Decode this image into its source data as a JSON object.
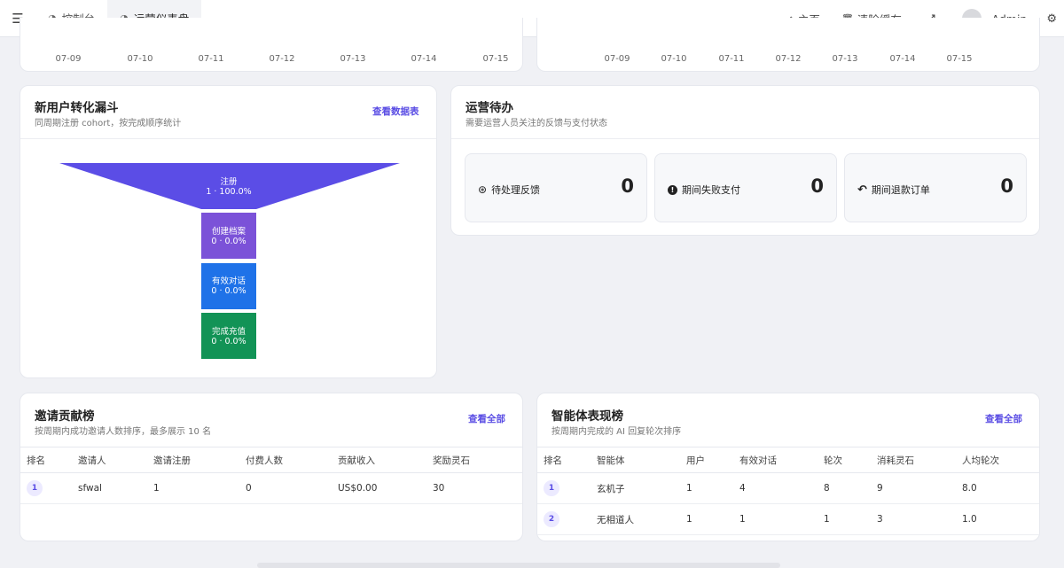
{
  "topbar": {
    "tabs": [
      {
        "label": "控制台",
        "icon": "dashboard-icon"
      },
      {
        "label": "运营仪表盘",
        "icon": "dashboard-icon",
        "active": true
      }
    ],
    "home_label": "主页",
    "clear_cache_label": "清除缓存",
    "user_name": "Admin"
  },
  "top_left_chart": {
    "x_ticks": [
      "07-09",
      "07-10",
      "07-11",
      "07-12",
      "07-13",
      "07-14",
      "07-15"
    ]
  },
  "top_right_chart": {
    "x_ticks": [
      "07-09",
      "07-10",
      "07-11",
      "07-12",
      "07-13",
      "07-14",
      "07-15"
    ]
  },
  "funnel": {
    "title": "新用户转化漏斗",
    "subtitle": "同周期注册 cohort，按完成顺序统计",
    "link": "查看数据表",
    "stages": [
      {
        "name": "注册",
        "value": "1 · 100.0%",
        "color": "#5b4de6"
      },
      {
        "name": "创建档案",
        "value": "0 · 0.0%",
        "color": "#7b52d8"
      },
      {
        "name": "有效对话",
        "value": "0 · 0.0%",
        "color": "#1f72e8"
      },
      {
        "name": "完成充值",
        "value": "0 · 0.0%",
        "color": "#129356"
      }
    ]
  },
  "todo": {
    "title": "运营待办",
    "subtitle": "需要运营人员关注的反馈与支付状态",
    "items": [
      {
        "label": "待处理反馈",
        "value": "0",
        "icon": "lifebuoy-icon"
      },
      {
        "label": "期间失败支付",
        "value": "0",
        "icon": "exclamation-icon"
      },
      {
        "label": "期间退款订单",
        "value": "0",
        "icon": "reply-icon"
      }
    ]
  },
  "invite": {
    "title": "邀请贡献榜",
    "subtitle": "按周期内成功邀请人数排序，最多展示 10 名",
    "link": "查看全部",
    "columns": [
      "排名",
      "邀请人",
      "邀请注册",
      "付费人数",
      "贡献收入",
      "奖励灵石"
    ],
    "rows": [
      [
        "1",
        "sfwal",
        "1",
        "0",
        "US$0.00",
        "30"
      ]
    ]
  },
  "agents": {
    "title": "智能体表现榜",
    "subtitle": "按周期内完成的 AI 回复轮次排序",
    "link": "查看全部",
    "columns": [
      "排名",
      "智能体",
      "用户",
      "有效对话",
      "轮次",
      "消耗灵石",
      "人均轮次"
    ],
    "rows": [
      [
        "1",
        "玄机子",
        "1",
        "4",
        "8",
        "9",
        "8.0"
      ],
      [
        "2",
        "无相道人",
        "1",
        "1",
        "1",
        "3",
        "1.0"
      ]
    ]
  }
}
